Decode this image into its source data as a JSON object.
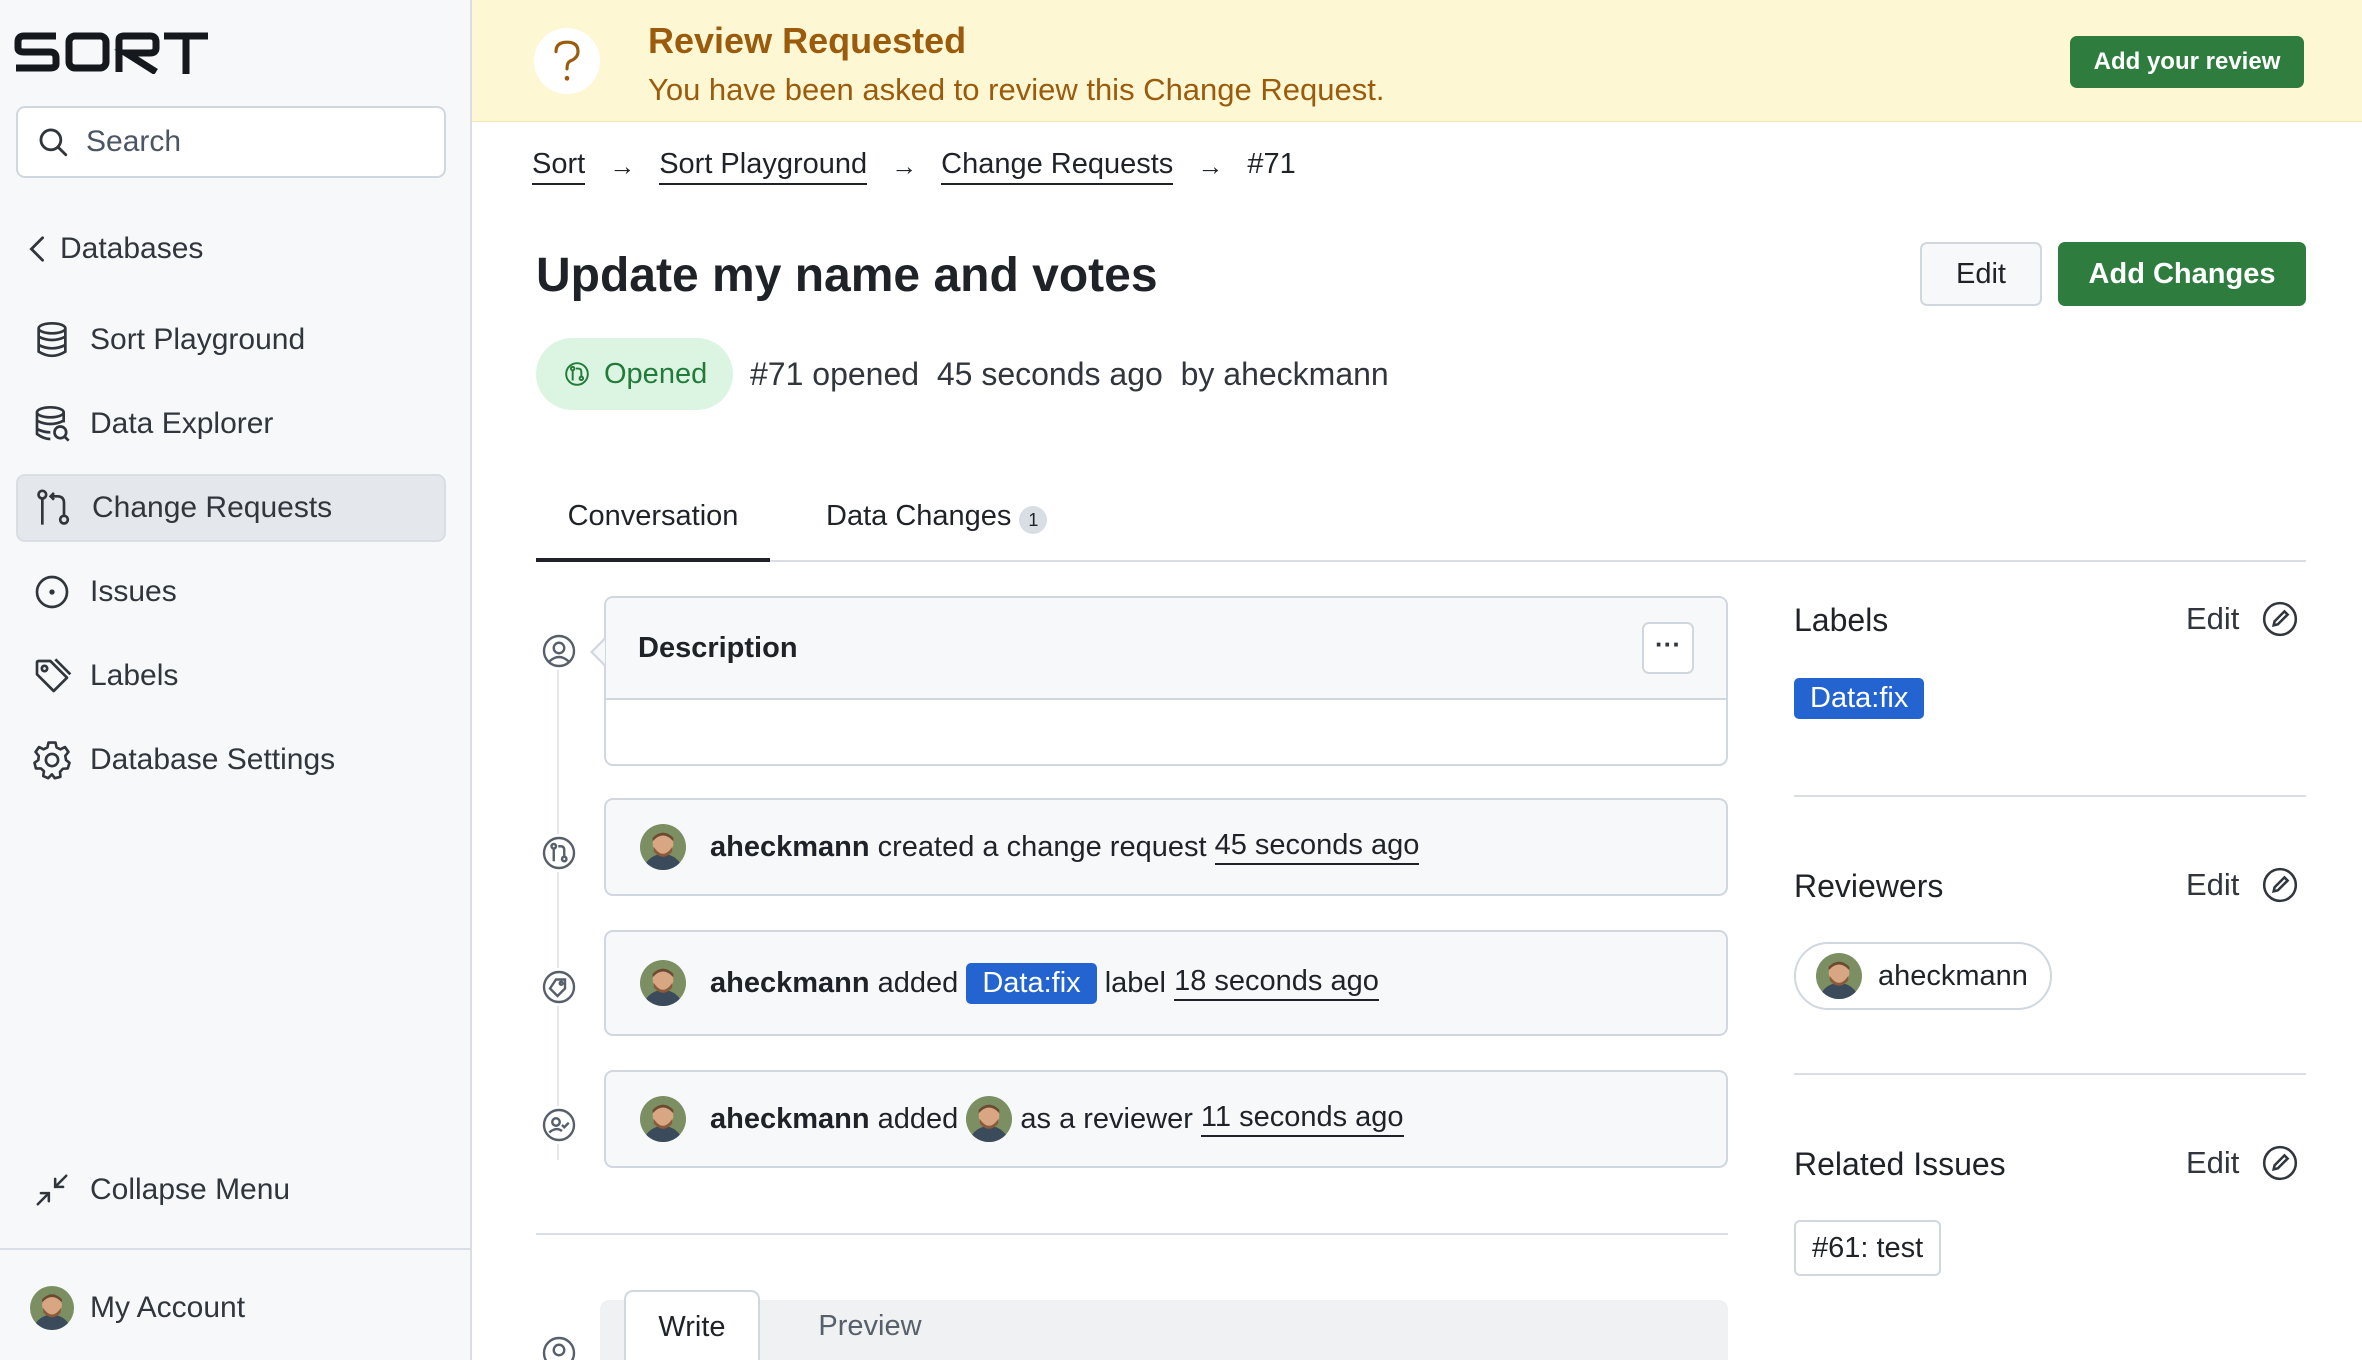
{
  "app": {
    "logo_text": "SORT"
  },
  "sidebar": {
    "search_placeholder": "Search",
    "back_label": "Databases",
    "items": [
      {
        "label": "Sort Playground",
        "icon": "database-icon"
      },
      {
        "label": "Data Explorer",
        "icon": "database-search-icon"
      },
      {
        "label": "Change Requests",
        "icon": "pull-request-icon"
      },
      {
        "label": "Issues",
        "icon": "issue-icon"
      },
      {
        "label": "Labels",
        "icon": "tag-icon"
      },
      {
        "label": "Database Settings",
        "icon": "gear-icon"
      }
    ],
    "collapse_label": "Collapse Menu",
    "account_label": "My Account"
  },
  "banner": {
    "title": "Review Requested",
    "text": "You have been asked to review this Change Request.",
    "button_label": "Add your review",
    "icon": "question-icon"
  },
  "breadcrumb": {
    "items": [
      "Sort",
      "Sort Playground",
      "Change Requests"
    ],
    "current": "#71"
  },
  "header": {
    "title": "Update my name and votes",
    "edit_label": "Edit",
    "add_changes_label": "Add Changes",
    "status": "Opened",
    "meta": "#71 opened  45 seconds ago  by aheckmann"
  },
  "tabs": [
    {
      "label": "Conversation"
    },
    {
      "label": "Data Changes",
      "count": "1"
    }
  ],
  "timeline": {
    "description": {
      "title": "Description",
      "more_label": "···"
    },
    "events": [
      {
        "user": "aheckmann",
        "text": " created a change request ",
        "time": "45 seconds ago"
      },
      {
        "user": "aheckmann",
        "text": " added ",
        "label": "Data:fix",
        "text2": " label ",
        "time": "18 seconds ago"
      },
      {
        "user": "aheckmann",
        "text": " added ",
        "text2": " as a reviewer ",
        "time": "11 seconds ago"
      }
    ]
  },
  "editor": {
    "write_label": "Write",
    "preview_label": "Preview"
  },
  "side": {
    "labels": {
      "title": "Labels",
      "edit_label": "Edit",
      "items": [
        "Data:fix"
      ]
    },
    "reviewers": {
      "title": "Reviewers",
      "edit_label": "Edit",
      "items": [
        "aheckmann"
      ]
    },
    "related": {
      "title": "Related Issues",
      "edit_label": "Edit",
      "items": [
        "#61: test"
      ]
    }
  },
  "colors": {
    "primary": "#2e7d3e",
    "label": "#2464d0",
    "banner_bg": "#fdf7d4",
    "banner_text": "#9a5b0d",
    "opened_bg": "#dcf5e3"
  }
}
